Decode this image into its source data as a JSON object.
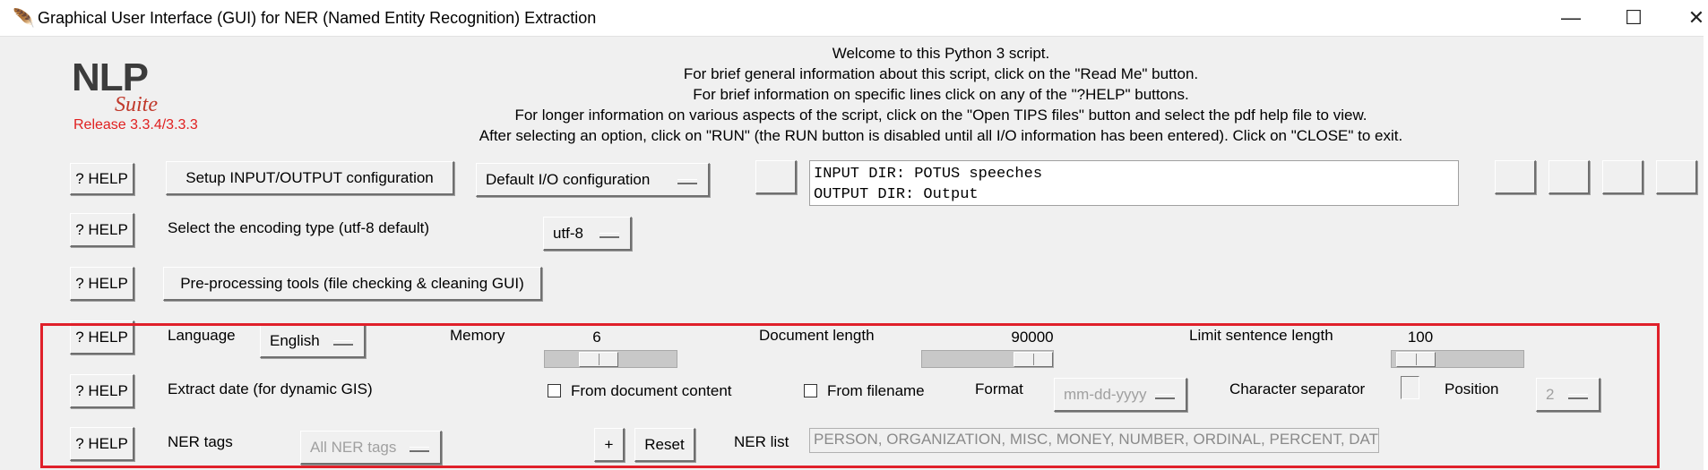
{
  "window": {
    "title": "Graphical User Interface (GUI) for NER (Named Entity Recognition) Extraction",
    "app_icon": "feather-icon",
    "controls": {
      "minimize": "—",
      "maximize": "☐",
      "close": "✕"
    }
  },
  "logo": {
    "nlp": "NLP",
    "suite": "Suite",
    "release": "Release 3.3.4/3.3.3"
  },
  "welcome": [
    "Welcome to this Python 3 script.",
    "For brief general information about this script, click on the \"Read Me\" button.",
    "For brief information on specific lines click on any of the \"?HELP\" buttons.",
    "For longer information on various aspects of the script, click on the \"Open TIPS files\" button and select the pdf help file to view.",
    "After selecting an option, click on \"RUN\" (the RUN button is disabled until all I/O information has been entered).   Click on \"CLOSE\" to exit."
  ],
  "help_label": "? HELP",
  "row_io": {
    "setup_button": "Setup INPUT/OUTPUT configuration",
    "io_menu": "Default I/O configuration",
    "io_text": [
      "INPUT DIR: POTUS speeches",
      "OUTPUT DIR: Output"
    ]
  },
  "row_encoding": {
    "label": "Select the encoding type (utf-8 default)",
    "value": "utf-8"
  },
  "row_preprocess": {
    "button": "Pre-processing tools (file checking & cleaning GUI)"
  },
  "row_language": {
    "language_label": "Language",
    "language_value": "English",
    "memory_label": "Memory",
    "memory_value": "6",
    "doclen_label": "Document length",
    "doclen_value": "90000",
    "sentlen_label": "Limit sentence length",
    "sentlen_value": "100"
  },
  "row_date": {
    "label": "Extract date (for dynamic GIS)",
    "from_content": "From document content",
    "from_content_checked": false,
    "from_filename": "From filename",
    "from_filename_checked": false,
    "format_label": "Format",
    "format_value": "mm-dd-yyyy",
    "char_sep_label": "Character separator",
    "position_label": "Position",
    "position_value": "2"
  },
  "row_ner": {
    "label": "NER tags",
    "tags_value": "All NER tags",
    "plus": "+",
    "reset": "Reset",
    "list_label": "NER list",
    "list_value": "PERSON, ORGANIZATION, MISC, MONEY, NUMBER, ORDINAL, PERCENT, DATE,"
  },
  "colors": {
    "highlight_border": "#e0202a",
    "release_text": "#e02020",
    "window_bg": "#f0f0f0"
  }
}
